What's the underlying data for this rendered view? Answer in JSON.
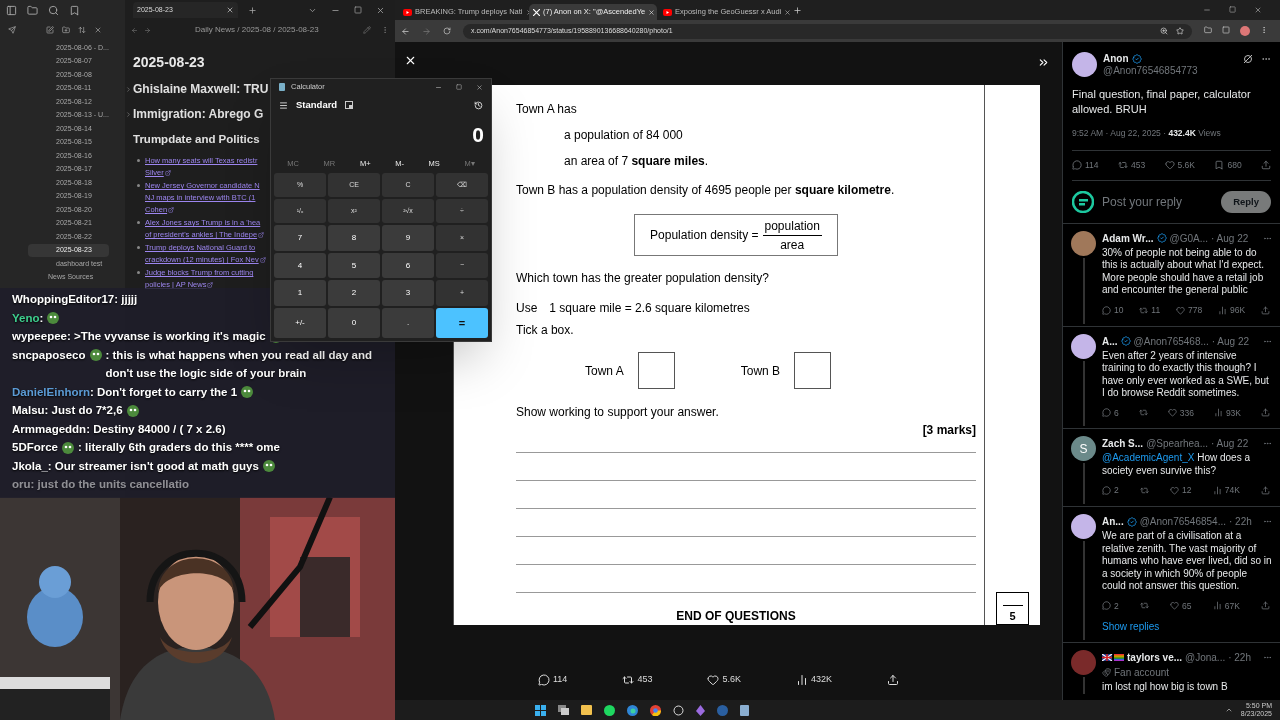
{
  "notes_app": {
    "tab": "2025-08-23",
    "breadcrumb": "Daily News / 2025-08 / 2025-08-23",
    "files": [
      {
        "label": "2025-08-06 - D...",
        "kind": "file",
        "selected": false
      },
      {
        "label": "2025-08-07",
        "kind": "file",
        "selected": false
      },
      {
        "label": "2025-08-08",
        "kind": "file",
        "selected": false
      },
      {
        "label": "2025-08-11",
        "kind": "file",
        "selected": false
      },
      {
        "label": "2025-08-12",
        "kind": "file",
        "selected": false
      },
      {
        "label": "2025-08-13 - U...",
        "kind": "file",
        "selected": false
      },
      {
        "label": "2025-08-14",
        "kind": "file",
        "selected": false
      },
      {
        "label": "2025-08-15",
        "kind": "file",
        "selected": false
      },
      {
        "label": "2025-08-16",
        "kind": "file",
        "selected": false
      },
      {
        "label": "2025-08-17",
        "kind": "file",
        "selected": false
      },
      {
        "label": "2025-08-18",
        "kind": "file",
        "selected": false
      },
      {
        "label": "2025-08-19",
        "kind": "file",
        "selected": false
      },
      {
        "label": "2025-08-20",
        "kind": "file",
        "selected": false
      },
      {
        "label": "2025-08-21",
        "kind": "file",
        "selected": false
      },
      {
        "label": "2025-08-22",
        "kind": "file",
        "selected": false
      },
      {
        "label": "2025-08-23",
        "kind": "file",
        "selected": true
      },
      {
        "label": "dashboard test",
        "kind": "file",
        "selected": false
      },
      {
        "label": "News Sources",
        "kind": "folder",
        "selected": false
      }
    ],
    "title": "2025-08-23",
    "headings": [
      {
        "text": "Ghislaine Maxwell: TRU",
        "expanded": false
      },
      {
        "text": "Immigration: Abrego G",
        "expanded": false
      }
    ],
    "section": "Trumpdate and Politics",
    "links": [
      {
        "lines": [
          "How many seats will Texas redistr",
          "Silver"
        ]
      },
      {
        "lines": [
          "New Jersey Governor candidate N",
          "NJ maps in interview with BTC (1",
          "Cohen"
        ]
      },
      {
        "lines": [
          "Alex Jones says Trump is in a 'hea",
          "of president's ankles | The Indepe"
        ]
      },
      {
        "lines": [
          "Trump deploys National Guard to",
          "crackdown (12 minutes) | Fox Nev"
        ]
      },
      {
        "lines": [
          "Judge blocks Trump from cutting",
          "policies | AP News"
        ]
      }
    ]
  },
  "chat": [
    {
      "user": "WhoppingEditor17",
      "color": "#ffffff",
      "text": ": jjjjj",
      "emote_before": false,
      "emote_after": false,
      "faded": false
    },
    {
      "user": "Yeno",
      "color": "#3ecf8e",
      "text": ":",
      "emote_before": false,
      "emote_after": true,
      "faded": false
    },
    {
      "user": "wypeepee",
      "color": "#ffffff",
      "text": ": >The vyvanse is working it's magic",
      "emote_before": false,
      "emote_after": true,
      "faded": false
    },
    {
      "user": "sncpaposeco",
      "color": "#ffffff",
      "text": ": this is what happens when you read all day and don't use the logic side of your brain",
      "emote_before": true,
      "emote_after": false,
      "faded": false
    },
    {
      "user": "DanielEinhorn",
      "color": "#5b9bd5",
      "text": ": Don't forget to carry the 1",
      "emote_before": false,
      "emote_after": true,
      "faded": false
    },
    {
      "user": "Malsu",
      "color": "#ffffff",
      "text": ": Just do 7*2,6",
      "emote_before": false,
      "emote_after": true,
      "faded": false
    },
    {
      "user": "Armmageddn",
      "color": "#ffffff",
      "text": ": Destiny 84000 / ( 7 x 2.6)",
      "emote_before": false,
      "emote_after": false,
      "faded": false
    },
    {
      "user": "5DForce",
      "color": "#ffffff",
      "text": ": literally 6th graders do this **** ome",
      "emote_before": true,
      "emote_after": false,
      "faded": false
    },
    {
      "user": "Jkola_",
      "color": "#ffffff",
      "text": ": Our streamer isn't good at math guys",
      "emote_before": false,
      "emote_after": true,
      "faded": false
    },
    {
      "user": "oru",
      "text": ": just do the units cancellatio",
      "emote_before": false,
      "emote_after": false,
      "faded": true
    }
  ],
  "calculator": {
    "title": "Calculator",
    "mode": "Standard",
    "display": "0",
    "memory": [
      {
        "label": "MC",
        "disabled": true
      },
      {
        "label": "MR",
        "disabled": true
      },
      {
        "label": "M+",
        "disabled": false
      },
      {
        "label": "M-",
        "disabled": false
      },
      {
        "label": "MS",
        "disabled": false
      },
      {
        "label": "M▾",
        "disabled": true
      }
    ],
    "keys": [
      {
        "label": "%",
        "kind": "fn"
      },
      {
        "label": "CE",
        "kind": "fn"
      },
      {
        "label": "C",
        "kind": "fn"
      },
      {
        "label": "⌫",
        "kind": "fn"
      },
      {
        "label": "¹/ₓ",
        "kind": "fn"
      },
      {
        "label": "x²",
        "kind": "fn"
      },
      {
        "label": "²√x",
        "kind": "fn"
      },
      {
        "label": "÷",
        "kind": "fn"
      },
      {
        "label": "7",
        "kind": "digit"
      },
      {
        "label": "8",
        "kind": "digit"
      },
      {
        "label": "9",
        "kind": "digit"
      },
      {
        "label": "×",
        "kind": "fn"
      },
      {
        "label": "4",
        "kind": "digit"
      },
      {
        "label": "5",
        "kind": "digit"
      },
      {
        "label": "6",
        "kind": "digit"
      },
      {
        "label": "−",
        "kind": "fn"
      },
      {
        "label": "1",
        "kind": "digit"
      },
      {
        "label": "2",
        "kind": "digit"
      },
      {
        "label": "3",
        "kind": "digit"
      },
      {
        "label": "+",
        "kind": "fn"
      },
      {
        "label": "+/-",
        "kind": "digit"
      },
      {
        "label": "0",
        "kind": "digit"
      },
      {
        "label": ".",
        "kind": "digit"
      },
      {
        "label": "=",
        "kind": "equals"
      }
    ]
  },
  "browser": {
    "tabs": [
      {
        "title": "BREAKING: Trump deploys Nati",
        "kind": "video",
        "selected": false
      },
      {
        "title": "(7) Anon on X: \"@AscendedYe",
        "kind": "x",
        "selected": true
      },
      {
        "title": "Exposing the GeoGuessr x Audi",
        "kind": "video",
        "selected": false
      }
    ],
    "url": "x.com/Anon76546854773/status/1958890136688640280/photo/1",
    "exam": {
      "intro": "Town A has",
      "facts": [
        "a population of 84 000",
        "an area of 7 **square miles**."
      ],
      "town_b": "Town B has a population density of 4695 people per **square kilometre**.",
      "formula": {
        "lhs": "Population density =",
        "numerator": "population",
        "denominator": "area"
      },
      "question": "Which town has the greater population density?",
      "use_label": "Use",
      "conversion": "1 square mile = 2.6 square kilometres",
      "instruction": "Tick a box.",
      "options": [
        {
          "label": "Town A",
          "checked": false
        },
        {
          "label": "Town B",
          "checked": false
        }
      ],
      "working": "Show working to support your answer.",
      "marks": "[3 marks]",
      "end": "END OF QUESTIONS",
      "page_mark": "5"
    },
    "photo_stats": {
      "replies": "114",
      "reposts": "453",
      "likes": "5.6K",
      "views": "432K"
    },
    "tweet": {
      "name": "Anon",
      "verified": true,
      "handle": "@Anon76546854773",
      "text": "Final question, final paper, calculator allowed. BRUH",
      "time": "9:52 AM · Aug 22, 2025 · ",
      "views": "432.4K",
      "views_label": " Views",
      "stats": {
        "replies": "114",
        "reposts": "453",
        "likes": "5.6K",
        "bookmarks": "680"
      }
    },
    "reply_box": {
      "placeholder": "Post your reply",
      "button": "Reply"
    },
    "replies": [
      {
        "name": "Adam Wr...",
        "verified": true,
        "handle": "@G0A...",
        "time": "· Aug 22",
        "text": "30% of people not being able to do this is actually about what I'd expect. More people should have a retail job and encounter the general public",
        "color": "#a0785a",
        "stats": {
          "replies": "10",
          "reposts": "11",
          "likes": "778",
          "views": "96K"
        }
      },
      {
        "name": "A...",
        "verified": true,
        "handle": "@Anon765468...",
        "time": "· Aug 22",
        "text": "Even after 2 years of intensive training to do exactly this though? I have only ever worked as a SWE, but I do browse Reddit sometimes.",
        "color": "#c4b5e8",
        "stats": {
          "replies": "6",
          "likes": "336",
          "views": "93K"
        }
      },
      {
        "name": "Zach S...",
        "verified": false,
        "handle": "@Spearhea...",
        "time": "· Aug 22",
        "mention": "@AcademicAgent_X",
        "text": " How does a society even survive this?",
        "color": "#6b8a8a",
        "initial": "S",
        "stats": {
          "replies": "2",
          "likes": "12",
          "views": "74K"
        }
      },
      {
        "name": "An...",
        "verified": true,
        "handle": "@Anon76546854...",
        "time": "· 22h",
        "text": "We are part of a civilisation at a relative zenith. The vast majority of humans who have ever lived, did so in a society in which 90% of people could not answer this question.",
        "color": "#c4b5e8",
        "stats": {
          "replies": "2",
          "likes": "65",
          "views": "67K"
        },
        "show_replies": "Show replies"
      },
      {
        "name": "taylors ve...",
        "verified": false,
        "flags": true,
        "handle": "@Jona...",
        "time": "· 22h",
        "label": "Fan account",
        "text": "im lost ngl how big is town B",
        "color": "#7a2a2a"
      }
    ]
  },
  "taskbar": {
    "time": "5:50 PM",
    "date": "8/23/2025"
  }
}
